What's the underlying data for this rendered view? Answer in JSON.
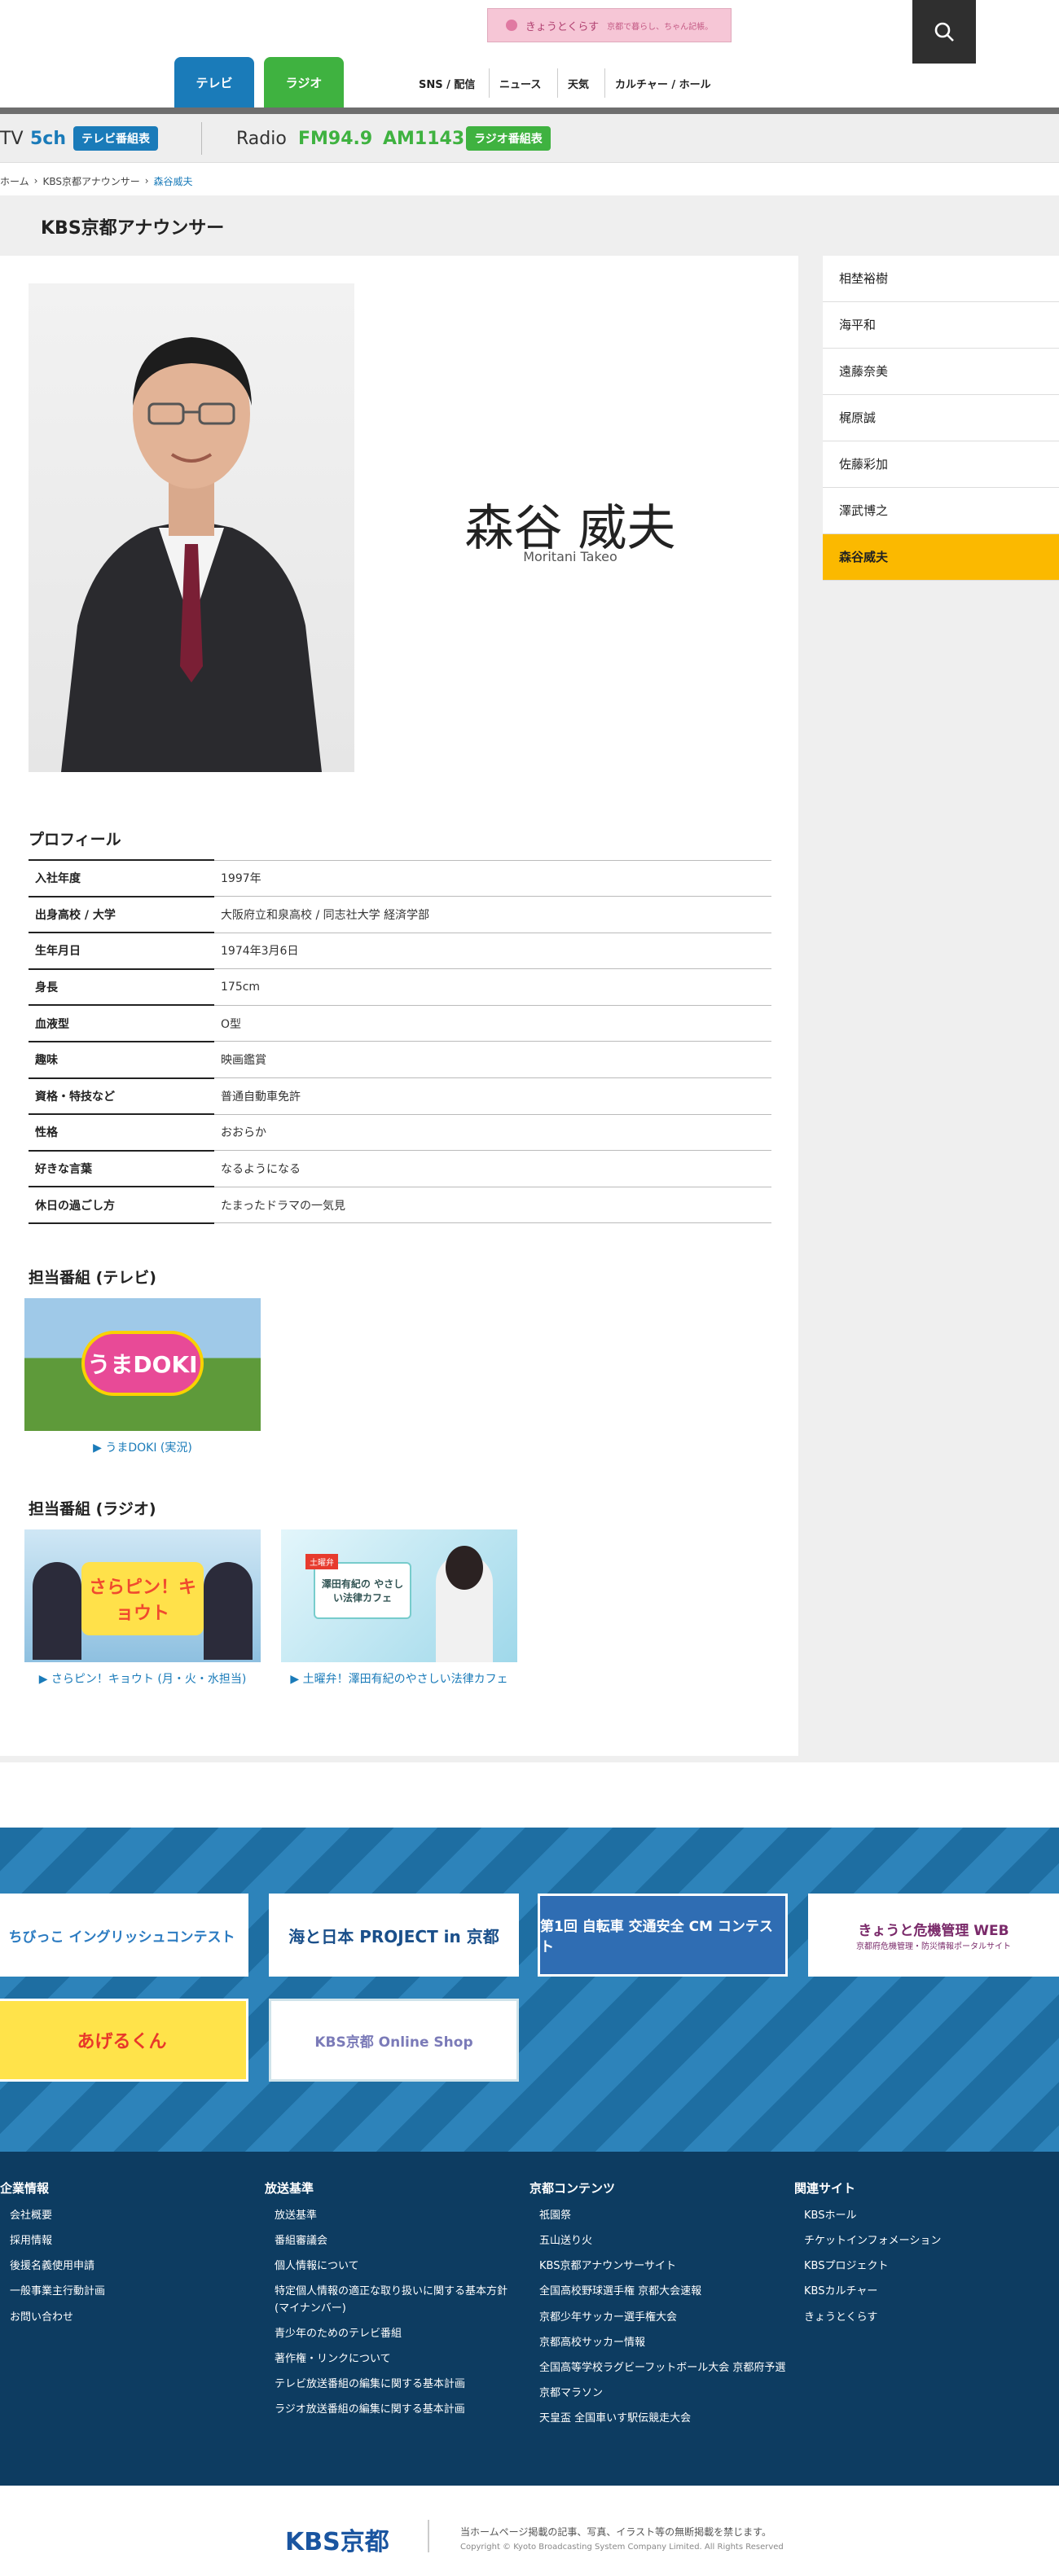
{
  "header": {
    "banner_text": "きょうとくらす",
    "banner_sub": "京都で暮らし、ちゃん記帳。",
    "tab_tv": "テレビ",
    "tab_radio": "ラジオ",
    "nav": [
      "SNS / 配信",
      "ニュース",
      "天気",
      "カルチャー / ホール"
    ]
  },
  "channel_bar": {
    "tv_label": "TV",
    "tv_channel": "5ch",
    "tv_button": "テレビ番組表",
    "radio_label": "Radio",
    "fm": "FM94.9",
    "am": "AM1143",
    "radio_button": "ラジオ番組表"
  },
  "breadcrumb": [
    "ホーム",
    "KBS京都アナウンサー",
    "森谷威夫"
  ],
  "page_title": "KBS京都アナウンサー",
  "announcer": {
    "name_jp": "森谷 威夫",
    "name_en": "Moritani Takeo"
  },
  "sidebar": {
    "items": [
      {
        "label": "相埜裕樹",
        "active": false
      },
      {
        "label": "海平和",
        "active": false
      },
      {
        "label": "遠藤奈美",
        "active": false
      },
      {
        "label": "梶原誠",
        "active": false
      },
      {
        "label": "佐藤彩加",
        "active": false
      },
      {
        "label": "澤武博之",
        "active": false
      },
      {
        "label": "森谷威夫",
        "active": true
      }
    ]
  },
  "profile": {
    "title": "プロフィール",
    "rows": [
      {
        "key": "入社年度",
        "value": "1997年"
      },
      {
        "key": "出身高校 / 大学",
        "value": "大阪府立和泉高校 / 同志社大学 経済学部"
      },
      {
        "key": "生年月日",
        "value": "1974年3月6日"
      },
      {
        "key": "身長",
        "value": "175cm"
      },
      {
        "key": "血液型",
        "value": "O型"
      },
      {
        "key": "趣味",
        "value": "映画鑑賞"
      },
      {
        "key": "資格・特技など",
        "value": "普通自動車免許"
      },
      {
        "key": "性格",
        "value": "おおらか"
      },
      {
        "key": "好きな言葉",
        "value": "なるようになる"
      },
      {
        "key": "休日の過ごし方",
        "value": "たまったドラマの一気見"
      }
    ]
  },
  "tv_programs": {
    "title": "担当番組 (テレビ)",
    "items": [
      {
        "caption": "うまDOKI (実況)",
        "image_text": "うまDOKI"
      }
    ]
  },
  "radio_programs": {
    "title": "担当番組 (ラジオ)",
    "items": [
      {
        "caption": "さらピン！キョウト (月・火・水担当)",
        "image_text": "さらピン！キョウト"
      },
      {
        "caption": "土曜弁！澤田有紀のやさしい法律カフェ",
        "image_text": "澤田有紀の やさしい法律カフェ",
        "image_badge": "土曜弁"
      }
    ]
  },
  "banners": [
    {
      "text": "ちびっこ イングリッシュコンテスト"
    },
    {
      "text": "海と日本 PROJECT in 京都"
    },
    {
      "text": "第1回 自転車 交通安全 CM コンテスト"
    },
    {
      "text": "きょうと危機管理 WEB",
      "sub": "京都府危機管理・防災情報ポータルサイト"
    },
    {
      "text": "あげるくん"
    },
    {
      "text": "KBS京都 Online Shop"
    }
  ],
  "footer": {
    "columns": [
      {
        "title": "企業情報",
        "links": [
          "会社概要",
          "採用情報",
          "後援名義使用申請",
          "一般事業主行動計画",
          "お問い合わせ"
        ]
      },
      {
        "title": "放送基準",
        "links": [
          "放送基準",
          "番組審議会",
          "個人情報について",
          "特定個人情報の適正な取り扱いに関する基本方針(マイナンバー)",
          "青少年のためのテレビ番組",
          "著作権・リンクについて",
          "テレビ放送番組の編集に関する基本計画",
          "ラジオ放送番組の編集に関する基本計画"
        ]
      },
      {
        "title": "京都コンテンツ",
        "links": [
          "祇園祭",
          "五山送り火",
          "KBS京都アナウンサーサイト",
          "全国高校野球選手権 京都大会速報",
          "京都少年サッカー選手権大会",
          "京都高校サッカー情報",
          "全国高等学校ラグビーフットボール大会 京都府予選",
          "京都マラソン",
          "天皇盃 全国車いす駅伝競走大会"
        ]
      },
      {
        "title": "関連サイト",
        "links": [
          "KBSホール",
          "チケットインフォメーション",
          "KBSプロジェクト",
          "KBSカルチャー",
          "きょうとくらす"
        ]
      }
    ],
    "logo": "KBS京都",
    "notice": "当ホームページ掲載の記事、写真、イラスト等の無断掲載を禁じます。",
    "copyright": "Copyright © Kyoto Broadcasting System Company Limited. All Rights Reserved"
  },
  "colors": {
    "tv_blue": "#1a7bb9",
    "radio_green": "#3fb240",
    "active_yellow": "#fbb900",
    "footer_navy": "#0d3c61"
  }
}
